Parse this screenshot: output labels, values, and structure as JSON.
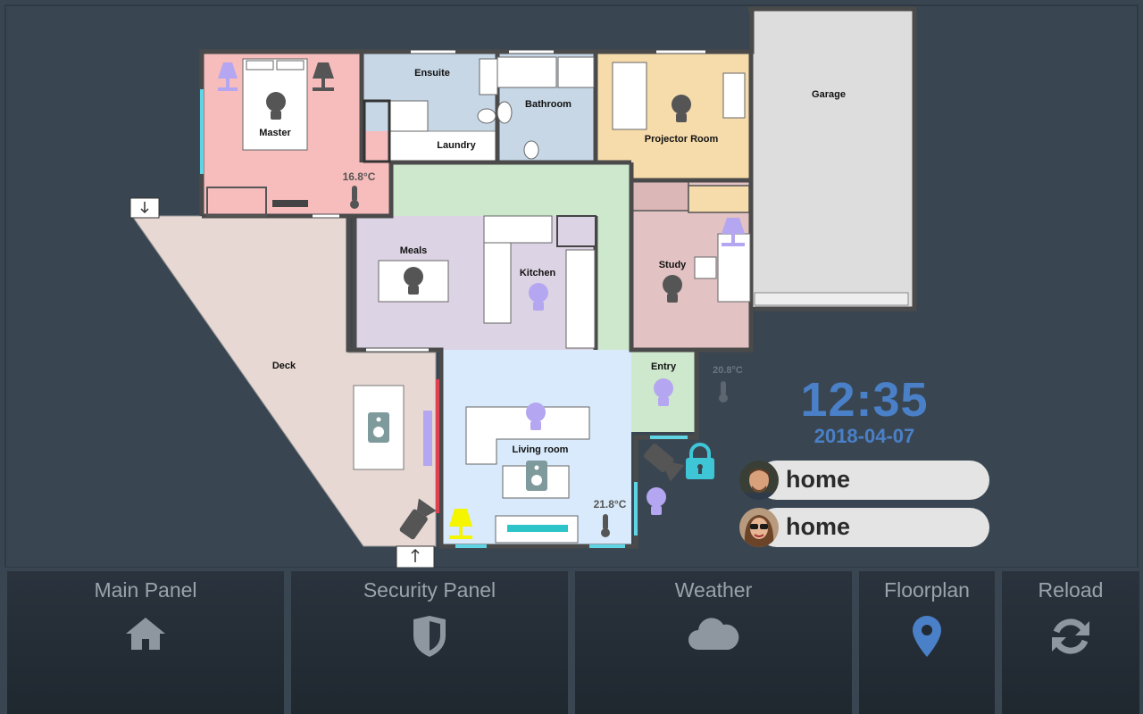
{
  "floorplan": {
    "rooms": [
      {
        "id": "master",
        "label": "Master"
      },
      {
        "id": "ensuite",
        "label": "Ensuite"
      },
      {
        "id": "bathroom",
        "label": "Bathroom"
      },
      {
        "id": "laundry",
        "label": "Laundry"
      },
      {
        "id": "projector",
        "label": "Projector Room"
      },
      {
        "id": "garage",
        "label": "Garage"
      },
      {
        "id": "meals",
        "label": "Meals"
      },
      {
        "id": "kitchen",
        "label": "Kitchen"
      },
      {
        "id": "study",
        "label": "Study"
      },
      {
        "id": "deck",
        "label": "Deck"
      },
      {
        "id": "entry",
        "label": "Entry"
      },
      {
        "id": "living",
        "label": "Living room"
      }
    ],
    "temperatures": {
      "master": "16.8°C",
      "entry": "20.8°C",
      "living": "21.8°C"
    }
  },
  "clock": {
    "time": "12:35",
    "date": "2018-04-07"
  },
  "people": [
    {
      "state": "home",
      "avatar": "person-male-avatar"
    },
    {
      "state": "home",
      "avatar": "person-female-avatar"
    }
  ],
  "nav": {
    "main": {
      "label": "Main Panel",
      "icon": "home-icon"
    },
    "security": {
      "label": "Security Panel",
      "icon": "shield-icon"
    },
    "weather": {
      "label": "Weather",
      "icon": "cloud-icon"
    },
    "floorplan": {
      "label": "Floorplan",
      "icon": "map-marker-icon"
    },
    "reload": {
      "label": "Reload",
      "icon": "refresh-icon"
    }
  },
  "colors": {
    "background": "#394652",
    "accent_blue": "#4a80c8",
    "lamp_on": "#f5f500",
    "light_off": "#555555",
    "light_dim": "#b4a6f0",
    "lock_teal": "#3fc6d6"
  }
}
